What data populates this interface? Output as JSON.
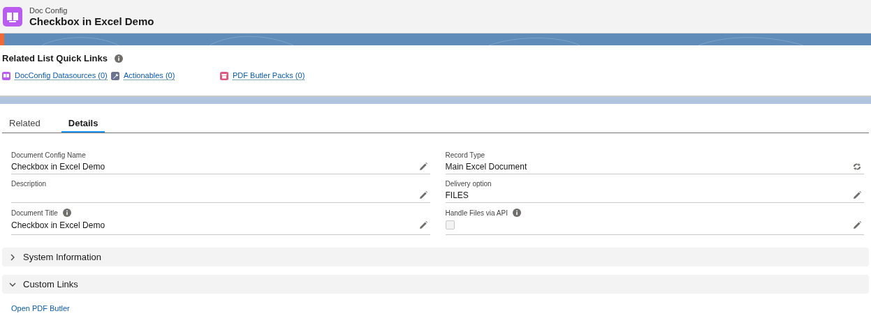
{
  "header": {
    "object_type": "Doc Config",
    "title": "Checkbox in Excel Demo"
  },
  "quick_links": {
    "title": "Related List Quick Links",
    "info": true,
    "links": [
      {
        "label": "DocConfig Datasources (0)",
        "color": "#ba5cf0",
        "kind": "book"
      },
      {
        "label": "Actionables (0)",
        "color": "#6b7390",
        "kind": "wrench"
      },
      {
        "label": "PDF Butler Packs (0)",
        "color": "#e0577f",
        "kind": "box"
      }
    ]
  },
  "tabs": [
    {
      "label": "Related",
      "selected": false
    },
    {
      "label": "Details",
      "selected": true
    }
  ],
  "fields": {
    "left": [
      {
        "label": "Document Config Name",
        "value": "Checkbox in Excel Demo",
        "kind": "text",
        "info": false
      },
      {
        "label": "Description",
        "kind": "text",
        "info": false
      },
      {
        "label": "Document Title",
        "value": "Checkbox in Excel Demo",
        "kind": "text",
        "info": true
      }
    ],
    "right": [
      {
        "label": "Record Type",
        "value": "Main Excel Document",
        "kind": "record_type",
        "info": false
      },
      {
        "label": "Delivery option",
        "value": "FILES",
        "kind": "text",
        "info": false
      },
      {
        "label": "Handle Files via API",
        "kind": "checkbox",
        "checked": false,
        "info": true
      }
    ]
  },
  "sections": [
    {
      "title": "System Information",
      "expanded": false
    },
    {
      "title": "Custom Links",
      "expanded": true,
      "links": [
        "Open PDF Butler"
      ]
    }
  ]
}
